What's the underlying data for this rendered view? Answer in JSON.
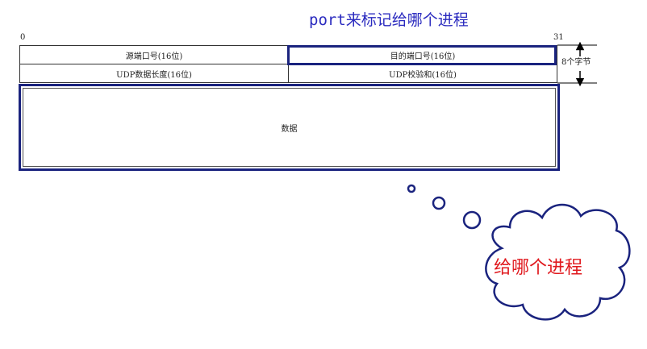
{
  "title": "port来标记给哪个进程",
  "bits": {
    "start": "0",
    "end": "31"
  },
  "header": {
    "row1": {
      "left": "源端口号(16位)",
      "right": "目的端口号(16位)"
    },
    "row2": {
      "left": "UDP数据长度(16位)",
      "right": "UDP校验和(16位)"
    },
    "size_label": "8个字节"
  },
  "data_label": "数据",
  "callout": {
    "text": "给哪个进程",
    "text_color": "#e0191e",
    "outline_color": "#1a237e"
  },
  "colors": {
    "title": "#2b2bbf",
    "highlight": "#1a237e"
  }
}
